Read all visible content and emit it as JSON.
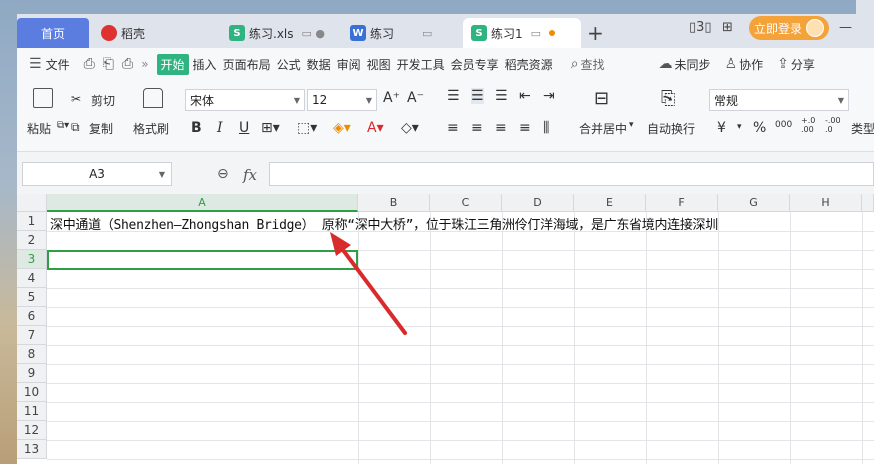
{
  "tabs": {
    "home": "首页",
    "items": [
      {
        "label": "稻壳",
        "icon": "wps-docer-icon"
      },
      {
        "label": "练习.xls",
        "icon": "spreadsheet-icon"
      },
      {
        "label": "练习",
        "icon": "word-doc-icon"
      },
      {
        "label": "练习1",
        "icon": "spreadsheet-icon"
      }
    ],
    "icon_letters": {
      "sheet": "S",
      "word": "W"
    },
    "new_tab": "+",
    "login": "立即登录"
  },
  "menu": {
    "file": "文件",
    "more": "»",
    "items": [
      "开始",
      "插入",
      "页面布局",
      "公式",
      "数据",
      "审阅",
      "视图",
      "开发工具",
      "会员专享",
      "稻壳资源"
    ],
    "search": "查找",
    "sync": "未同步",
    "collab": "协作",
    "share": "分享"
  },
  "ribbon": {
    "paste": "粘贴",
    "cut": "剪切",
    "copy": "复制",
    "format_painter": "格式刷",
    "font_name": "宋体",
    "font_size": "12",
    "bold": "B",
    "italic": "I",
    "underline": "U",
    "merge_center": "合并居中",
    "wrap_text": "自动换行",
    "number_format": "常规",
    "currency": "¥",
    "percent": "%",
    "thousands": "000",
    "inc_decimal": "+.0 .00",
    "dec_decimal": "-.00 .0",
    "type_convert": "类型"
  },
  "formula_bar": {
    "name_box": "A3",
    "fx": "fx",
    "content": ""
  },
  "grid": {
    "columns": [
      "A",
      "B",
      "C",
      "D",
      "E",
      "F",
      "G",
      "H"
    ],
    "rows": [
      "1",
      "2",
      "3",
      "4",
      "5",
      "6",
      "7",
      "8",
      "9",
      "10",
      "11",
      "12",
      "13"
    ],
    "selected_cell": "A3",
    "cell_A1": "深中通道（Shenzhen–Zhongshan Bridge） 原称“深中大桥”，位于珠江三角洲伶仃洋海域，是广东省境内连接深圳"
  },
  "colors": {
    "accent_green": "#2f9e44",
    "home_tab": "#5b7de0",
    "login_orange": "#f4a23a",
    "arrow_red": "#d92b2b"
  }
}
